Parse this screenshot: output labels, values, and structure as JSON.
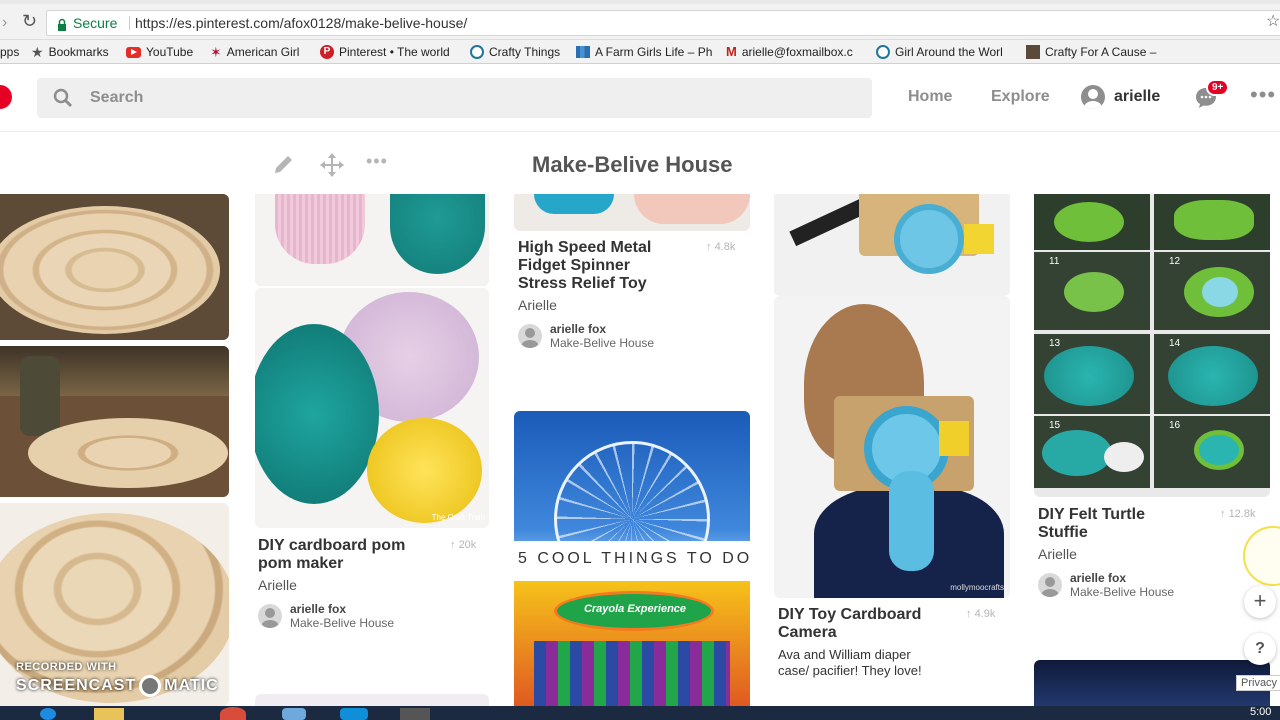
{
  "browser": {
    "secure_label": "Secure",
    "url": "https://es.pinterest.com/afox0128/make-belive-house/",
    "bookmarks": [
      {
        "label": "pps",
        "icon": "apps-icon"
      },
      {
        "label": "Bookmarks",
        "icon": "star-icon"
      },
      {
        "label": "YouTube",
        "icon": "youtube-icon"
      },
      {
        "label": "American Girl",
        "icon": "american-girl-icon"
      },
      {
        "label": "Pinterest • The world",
        "icon": "pinterest-icon"
      },
      {
        "label": "Crafty Things",
        "icon": "wordpress-icon"
      },
      {
        "label": "A Farm Girls Life – Ph",
        "icon": "chart-icon"
      },
      {
        "label": "arielle@foxmailbox.c",
        "icon": "gmail-icon"
      },
      {
        "label": "Girl Around the Worl",
        "icon": "wordpress-icon"
      },
      {
        "label": "Crafty For A Cause –",
        "icon": "site-icon"
      }
    ]
  },
  "header": {
    "search_placeholder": "Search",
    "nav_home": "Home",
    "nav_explore": "Explore",
    "user_name": "arielle",
    "notif_badge": "9+"
  },
  "board": {
    "title": "Make-Belive House"
  },
  "pins": [
    {
      "title": "DIY cardboard pom pom maker",
      "count": "20k",
      "author": "Arielle",
      "pinner": "arielle fox",
      "board": "Make-Belive House"
    },
    {
      "title": "High Speed Metal Fidget Spinner Stress Relief Toy",
      "count": "4.8k",
      "author": "Arielle",
      "pinner": "arielle fox",
      "board": "Make-Belive House"
    },
    {
      "title": "DIY Toy Cardboard Camera",
      "count": "4.9k",
      "desc": "Ava and William diaper case/ pacifier! They love!"
    },
    {
      "title": "DIY Felt Turtle Stuffie",
      "count": "12.8k",
      "author": "Arielle",
      "pinner": "arielle fox",
      "board": "Make-Belive House"
    }
  ],
  "image_text": {
    "cool_things": "5 COOL THINGS TO DO",
    "crayola": "Crayola Experience",
    "watermark_tra": "The Craft Train",
    "watermark_camera": "mollymoocrafts",
    "turtle_steps": [
      "11",
      "12",
      "13",
      "14",
      "15",
      "16"
    ]
  },
  "overlay": {
    "recorded_with": "RECORDED WITH",
    "screencast": "SCREENCAST",
    "matic": "MATIC"
  },
  "floating": {
    "privacy": "Privacy",
    "help": "?",
    "plus": "+"
  },
  "taskbar": {
    "clock": "5:00"
  }
}
